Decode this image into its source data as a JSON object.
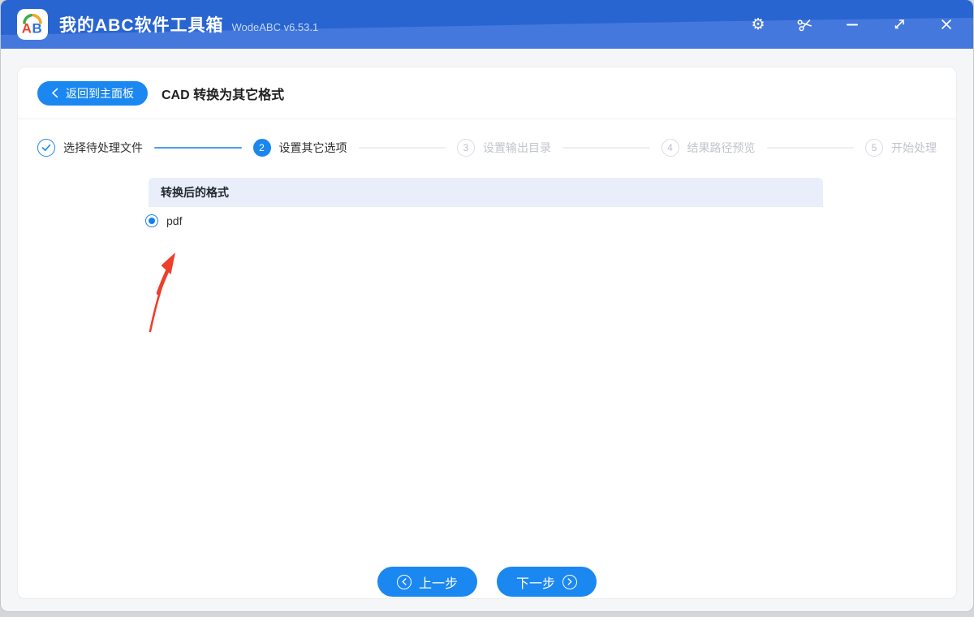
{
  "titlebar": {
    "app_title": "我的ABC软件工具箱",
    "version": "WodeABC v6.53.1",
    "app_icon_letters": {
      "a": "A",
      "b": "B"
    },
    "controls": [
      {
        "name": "settings",
        "icon": "gear-icon",
        "glyph": "⚙"
      },
      {
        "name": "screenshot",
        "icon": "scissors-icon"
      },
      {
        "name": "minimize",
        "icon": "minus-icon"
      },
      {
        "name": "resize",
        "icon": "diagonal-arrows-icon"
      },
      {
        "name": "close",
        "icon": "x-icon"
      }
    ]
  },
  "header": {
    "back_button": "返回到主面板",
    "page_title": "CAD 转换为其它格式"
  },
  "wizard": {
    "steps": [
      {
        "num": "1",
        "label": "选择待处理文件",
        "state": "done"
      },
      {
        "num": "2",
        "label": "设置其它选项",
        "state": "active"
      },
      {
        "num": "3",
        "label": "设置输出目录",
        "state": "pending"
      },
      {
        "num": "4",
        "label": "结果路径预览",
        "state": "pending"
      },
      {
        "num": "5",
        "label": "开始处理",
        "state": "pending"
      }
    ],
    "connectors": [
      "done",
      "pending",
      "pending",
      "pending"
    ]
  },
  "content": {
    "panel_title": "转换后的格式",
    "options": [
      {
        "label": "pdf",
        "state": "selected"
      }
    ]
  },
  "footer": {
    "prev_label": "上一步",
    "next_label": "下一步"
  },
  "colors": {
    "accent_blue": "#1b87f0",
    "titlebar_top": "#2865d1",
    "titlebar_bottom": "#4578dd",
    "panel_header_bg": "#e9eefa",
    "step_gray": "#c0c4cc",
    "annotation_red": "#ee3e2c"
  }
}
